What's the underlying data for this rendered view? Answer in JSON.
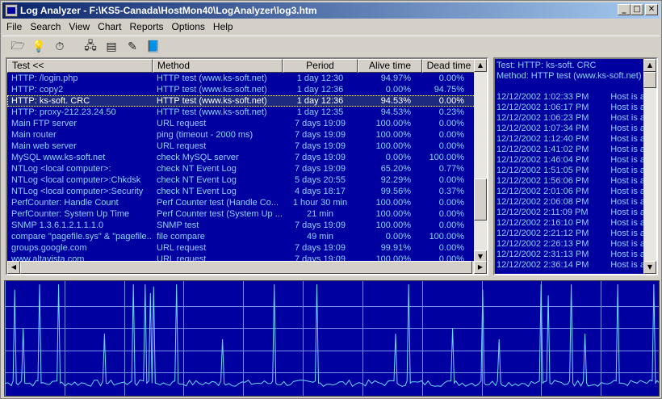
{
  "window": {
    "title": "Log Analyzer - F:\\KS5-Canada\\HostMon40\\LogAnalyzer\\log3.htm"
  },
  "title_buttons": {
    "minimize": "_",
    "maximize": "□",
    "close": "✕"
  },
  "menu": [
    "File",
    "Search",
    "View",
    "Chart",
    "Reports",
    "Options",
    "Help"
  ],
  "toolbar": [
    {
      "name": "open-folder-icon",
      "glyph": "🗁"
    },
    {
      "name": "bulb-icon",
      "glyph": "💡"
    },
    {
      "name": "stopwatch-icon",
      "glyph": "⏱"
    },
    {
      "name": "computers-icon",
      "glyph": "🖧"
    },
    {
      "name": "report-icon",
      "glyph": "▤"
    },
    {
      "name": "wizard-icon",
      "glyph": "✎"
    },
    {
      "name": "book-icon",
      "glyph": "📘"
    }
  ],
  "table": {
    "columns": [
      "Test <<",
      "Method",
      "Period",
      "Alive time",
      "Dead time"
    ],
    "rows": [
      [
        "HTTP: /login.php",
        "HTTP test (www.ks-soft.net)",
        "1 day 12:30",
        "94.97%",
        "0.00%"
      ],
      [
        "HTTP: copy2",
        "HTTP test (www.ks-soft.net)",
        "1 day 12:36",
        "0.00%",
        "94.75%"
      ],
      [
        "HTTP: ks-soft. CRC",
        "HTTP test (www.ks-soft.net)",
        "1 day 12:36",
        "94.53%",
        "0.00%"
      ],
      [
        "HTTP: proxy-212.23.24.50",
        "HTTP test (www.ks-soft.net)",
        "1 day 12:35",
        "94.53%",
        "0.23%"
      ],
      [
        "Main FTP server",
        "URL request",
        "7 days 19:09",
        "100.00%",
        "0.00%"
      ],
      [
        "Main router",
        "ping (timeout - 2000 ms)",
        "7 days 19:09",
        "100.00%",
        "0.00%"
      ],
      [
        "Main web server",
        "URL request",
        "7 days 19:09",
        "100.00%",
        "0.00%"
      ],
      [
        "MySQL www.ks-soft.net",
        "check MySQL server",
        "7 days 19:09",
        "0.00%",
        "100.00%"
      ],
      [
        "NTLog <local computer>:",
        "check NT Event Log",
        "7 days 19:09",
        "65.20%",
        "0.77%"
      ],
      [
        "NTLog <local computer>:Chkdsk",
        "check NT Event Log",
        "5 days 20:55",
        "92.29%",
        "0.00%"
      ],
      [
        "NTLog <local computer>:Security",
        "check NT Event Log",
        "4 days 18:17",
        "99.56%",
        "0.37%"
      ],
      [
        "PerfCounter: Handle Count",
        "Perf Counter test (Handle Co...",
        "1 hour 30 min",
        "100.00%",
        "0.00%"
      ],
      [
        "PerfCounter: System Up Time",
        "Perf Counter test (System Up ...",
        "21 min",
        "100.00%",
        "0.00%"
      ],
      [
        "SNMP 1.3.6.1.2.1.1.1.0",
        "SNMP test",
        "7 days 19:09",
        "100.00%",
        "0.00%"
      ],
      [
        "compare \"pagefile.sys\" & \"pagefile...",
        "file compare",
        "49 min",
        "0.00%",
        "100.00%"
      ],
      [
        "groups.google.com",
        "URL request",
        "7 days 19:09",
        "99.91%",
        "0.00%"
      ],
      [
        "www.altavista.com",
        "URL request",
        "7 days 19:09",
        "100.00%",
        "0.00%"
      ]
    ],
    "selected_index": 2
  },
  "details": {
    "test": "Test: HTTP: ks-soft. CRC",
    "method": "Method: HTTP test (www.ks-soft.net)",
    "log": [
      [
        "12/12/2002 1:02:33 PM",
        "Host is a"
      ],
      [
        "12/12/2002 1:06:17 PM",
        "Host is a"
      ],
      [
        "12/12/2002 1:06:23 PM",
        "Host is a"
      ],
      [
        "12/12/2002 1:07:34 PM",
        "Host is a"
      ],
      [
        "12/12/2002 1:12:40 PM",
        "Host is a"
      ],
      [
        "12/12/2002 1:41:02 PM",
        "Host is a"
      ],
      [
        "12/12/2002 1:46:04 PM",
        "Host is a"
      ],
      [
        "12/12/2002 1:51:05 PM",
        "Host is a"
      ],
      [
        "12/12/2002 1:56:06 PM",
        "Host is a"
      ],
      [
        "12/12/2002 2:01:06 PM",
        "Host is a"
      ],
      [
        "12/12/2002 2:06:08 PM",
        "Host is a"
      ],
      [
        "12/12/2002 2:11:09 PM",
        "Host is a"
      ],
      [
        "12/12/2002 2:16:10 PM",
        "Host is a"
      ],
      [
        "12/12/2002 2:21:12 PM",
        "Host is a"
      ],
      [
        "12/12/2002 2:26:13 PM",
        "Host is a"
      ],
      [
        "12/12/2002 2:31:13 PM",
        "Host is a"
      ],
      [
        "12/12/2002 2:36:14 PM",
        "Host is a"
      ]
    ]
  },
  "colors": {
    "panel_bg": "#0000a0",
    "row_text": "#8fd0ff",
    "selected_text": "#ffffff",
    "chart_line": "#6fd8ff",
    "grid": "#6f8fe8"
  },
  "chart_data": {
    "type": "line",
    "grid": true,
    "baseline": 10,
    "spikes": [
      {
        "x": 0.015,
        "v": 95
      },
      {
        "x": 0.028,
        "v": 60
      },
      {
        "x": 0.053,
        "v": 100
      },
      {
        "x": 0.082,
        "v": 100
      },
      {
        "x": 0.152,
        "v": 55
      },
      {
        "x": 0.196,
        "v": 100
      },
      {
        "x": 0.214,
        "v": 100
      },
      {
        "x": 0.222,
        "v": 92
      },
      {
        "x": 0.227,
        "v": 98
      },
      {
        "x": 0.262,
        "v": 100
      },
      {
        "x": 0.332,
        "v": 50
      },
      {
        "x": 0.411,
        "v": 100
      },
      {
        "x": 0.476,
        "v": 100
      },
      {
        "x": 0.596,
        "v": 55
      },
      {
        "x": 0.616,
        "v": 100
      },
      {
        "x": 0.683,
        "v": 60
      },
      {
        "x": 0.729,
        "v": 95
      },
      {
        "x": 0.754,
        "v": 50
      },
      {
        "x": 0.818,
        "v": 100
      },
      {
        "x": 0.829,
        "v": 90
      },
      {
        "x": 0.864,
        "v": 100
      },
      {
        "x": 0.885,
        "v": 55
      },
      {
        "x": 0.935,
        "v": 100
      },
      {
        "x": 0.99,
        "v": 100
      }
    ]
  }
}
